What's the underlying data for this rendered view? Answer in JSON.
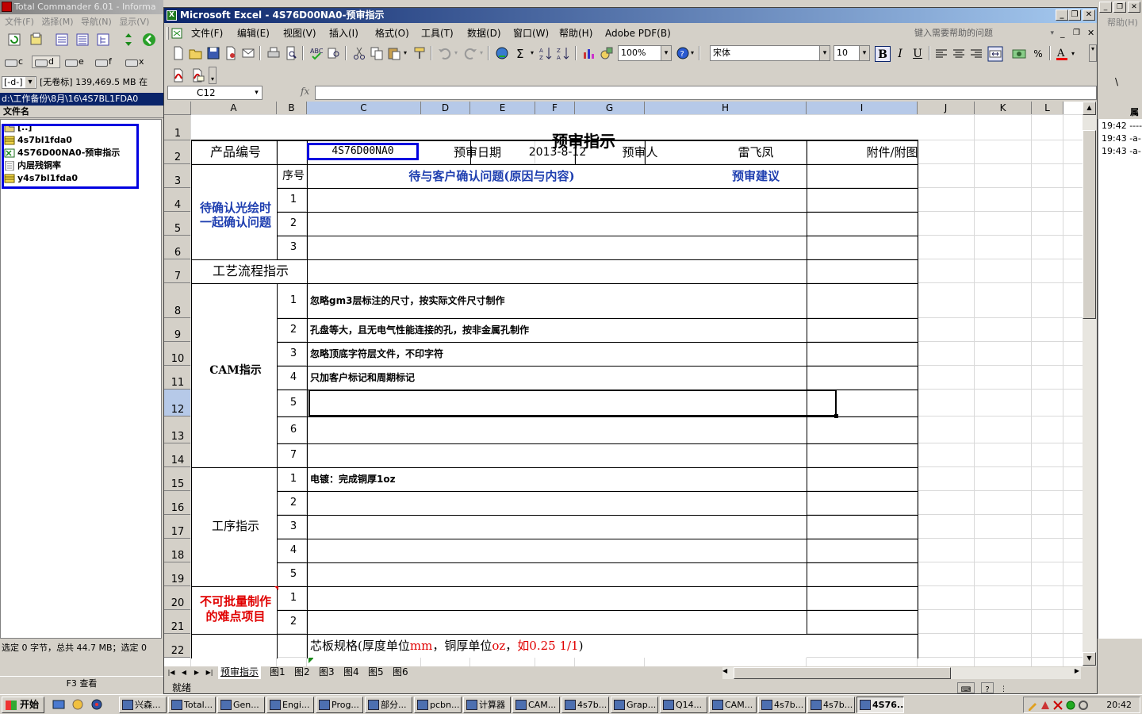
{
  "total_commander": {
    "title": "Total Commander 6.01 - Informa",
    "menu": [
      "文件(F)",
      "选择(M)",
      "导航(N)",
      "显示(V)"
    ],
    "drives": [
      "c",
      "d",
      "e",
      "f",
      "x"
    ],
    "drive_select": "[-d-]",
    "drive_info": "[无卷标]  139,469.5 MB 在",
    "path": "d:\\工作备份\\8月\\16\\4S7BL1FDA0",
    "column_header": "文件名",
    "files": [
      {
        "name": "[..]",
        "icon": "up-folder-icon"
      },
      {
        "name": "4s7bl1fda0",
        "icon": "archive-icon"
      },
      {
        "name": "4S76D00NA0-预审指示",
        "icon": "excel-file-icon"
      },
      {
        "name": "内层残铜率",
        "icon": "document-icon"
      },
      {
        "name": "y4s7bl1fda0",
        "icon": "archive-icon"
      }
    ],
    "status": "选定 0 字节，总共 44.7 MB；选定 0",
    "f3_button": "F3 查看"
  },
  "right_window": {
    "help": "帮助(H)",
    "column_header": "属",
    "lines": [
      "19:42 ----",
      "19:43 -a-",
      "19:43 -a-"
    ],
    "toolbar_text": "\\"
  },
  "excel": {
    "title": "Microsoft Excel - 4S76D00NA0-预审指示",
    "menu": [
      "文件(F)",
      "编辑(E)",
      "视图(V)",
      "插入(I)",
      "格式(O)",
      "工具(T)",
      "数据(D)",
      "窗口(W)",
      "帮助(H)",
      "Adobe PDF(B)"
    ],
    "ask_question": "键入需要帮助的问题",
    "zoom": "100%",
    "font_name": "宋体",
    "font_size": "10",
    "name_box": "C12",
    "fx_label": "fx",
    "formula": "",
    "columns": [
      "A",
      "B",
      "C",
      "D",
      "E",
      "F",
      "G",
      "H",
      "I",
      "J",
      "K",
      "L"
    ],
    "rows": [
      "1",
      "2",
      "3",
      "4",
      "5",
      "6",
      "7",
      "8",
      "9",
      "10",
      "11",
      "12",
      "13",
      "14",
      "15",
      "16",
      "17",
      "18",
      "19",
      "20",
      "21",
      "22"
    ],
    "sheet": {
      "title": "预审指示",
      "product_no_label": "产品编号",
      "product_no": "4S76D00NA0",
      "review_date_label": "预审日期",
      "review_date": "2013-8-12",
      "reviewer_label": "预审人",
      "reviewer": "雷飞凤",
      "attachment_label": "附件/附图",
      "seq_label": "序号",
      "confirm_header": "待与客户确认问题(原因与内容)",
      "suggestion_header": "预审建议",
      "pending_label_1": "待确认光绘时",
      "pending_label_2": "一起确认问题",
      "pending_nums": [
        "1",
        "2",
        "3"
      ],
      "process_label": "工艺流程指示",
      "cam_label": "CAM指示",
      "cam_nums": [
        "1",
        "2",
        "3",
        "4",
        "5",
        "6",
        "7"
      ],
      "cam_items": [
        "忽略gm3层标注的尺寸，按实际文件尺寸制作",
        "孔盘等大，且无电气性能连接的孔，按非金属孔制作",
        "忽略顶底字符层文件，不印字符",
        "只加客户标记和周期标记"
      ],
      "proc_label": "工序指示",
      "proc_nums": [
        "1",
        "2",
        "3",
        "4",
        "5"
      ],
      "proc_items": [
        "电镀：完成铜厚1oz"
      ],
      "difficult_label_1": "不可批量制作",
      "difficult_label_2": "的难点项目",
      "difficult_nums": [
        "1",
        "2"
      ],
      "core_prefix": "芯板规格(厚度单位",
      "core_mm": "mm",
      "core_mid": "，铜厚单位",
      "core_oz": "oz",
      "core_comma": "，",
      "core_example": "如0.25 1/1",
      "core_suffix": ")"
    },
    "tabs": [
      "预审指示",
      "图1",
      "图2",
      "图3",
      "图4",
      "图5",
      "图6"
    ],
    "status": "就绪"
  },
  "taskbar": {
    "start": "开始",
    "tasks": [
      "兴森...",
      "Total...",
      "Gen...",
      "Engi...",
      "Prog...",
      "部分...",
      "pcbn...",
      "计算器",
      "CAM...",
      "4s7b...",
      "Grap...",
      "Q14...",
      "CAM...",
      "4s7b...",
      "4s7b...",
      "4S76..."
    ],
    "clock": "20:42"
  },
  "colors": {
    "title_blue": "#0a246a",
    "highlight_box": "#0000e0",
    "accent_blue_text": "#1f3fb0",
    "accent_red_text": "#e00000"
  }
}
